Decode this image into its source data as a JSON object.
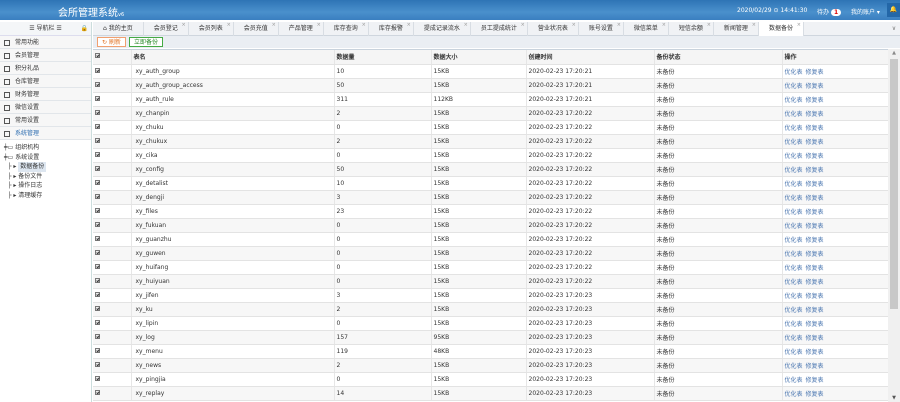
{
  "header": {
    "title": "会所管理系统",
    "version": "v6",
    "datetime": "2020/02/29 ⊙ 14:41:30",
    "todo_label": "待办",
    "todo_count": "1",
    "account": "我的账户 ▾"
  },
  "sidebar": {
    "title": "☰ 导航栏 ☰",
    "menus": [
      "常用功能",
      "会员管理",
      "积分礼品",
      "仓库管理",
      "财务管理",
      "微信设置",
      "常用设置",
      "系统管理"
    ],
    "tree": {
      "org": "组织机构",
      "sys": "系统设置",
      "children": [
        "数据备份",
        "备份文件",
        "操作日志",
        "清理缓存"
      ]
    }
  },
  "tabs": [
    "我的主页",
    "会员登记",
    "会员列表",
    "会员充值",
    "产品管理",
    "库存查询",
    "库存报警",
    "提成记录流水",
    "员工提成统计",
    "营业状况表",
    "账号设置",
    "微信菜单",
    "短信余额",
    "新闻管理",
    "数据备份"
  ],
  "toolbar": {
    "refresh": "↻ 刷新",
    "backup": "立即备份"
  },
  "table": {
    "columns": [
      "表名",
      "数据量",
      "数据大小",
      "创建时间",
      "备份状态",
      "操作"
    ],
    "actions": [
      "优化表",
      "修复表"
    ],
    "rows": [
      [
        "xy_auth_group",
        "10",
        "15KB",
        "2020-02-23 17:20:21",
        "未备份"
      ],
      [
        "xy_auth_group_access",
        "50",
        "15KB",
        "2020-02-23 17:20:21",
        "未备份"
      ],
      [
        "xy_auth_rule",
        "311",
        "112KB",
        "2020-02-23 17:20:21",
        "未备份"
      ],
      [
        "xy_chanpin",
        "2",
        "15KB",
        "2020-02-23 17:20:22",
        "未备份"
      ],
      [
        "xy_chuku",
        "0",
        "15KB",
        "2020-02-23 17:20:22",
        "未备份"
      ],
      [
        "xy_chukux",
        "2",
        "15KB",
        "2020-02-23 17:20:22",
        "未备份"
      ],
      [
        "xy_cika",
        "0",
        "15KB",
        "2020-02-23 17:20:22",
        "未备份"
      ],
      [
        "xy_config",
        "50",
        "15KB",
        "2020-02-23 17:20:22",
        "未备份"
      ],
      [
        "xy_detalist",
        "10",
        "15KB",
        "2020-02-23 17:20:22",
        "未备份"
      ],
      [
        "xy_dengji",
        "3",
        "15KB",
        "2020-02-23 17:20:22",
        "未备份"
      ],
      [
        "xy_files",
        "23",
        "15KB",
        "2020-02-23 17:20:22",
        "未备份"
      ],
      [
        "xy_fukuan",
        "0",
        "15KB",
        "2020-02-23 17:20:22",
        "未备份"
      ],
      [
        "xy_guanzhu",
        "0",
        "15KB",
        "2020-02-23 17:20:22",
        "未备份"
      ],
      [
        "xy_guwen",
        "0",
        "15KB",
        "2020-02-23 17:20:22",
        "未备份"
      ],
      [
        "xy_huifang",
        "0",
        "15KB",
        "2020-02-23 17:20:22",
        "未备份"
      ],
      [
        "xy_huiyuan",
        "0",
        "15KB",
        "2020-02-23 17:20:22",
        "未备份"
      ],
      [
        "xy_jifen",
        "3",
        "15KB",
        "2020-02-23 17:20:23",
        "未备份"
      ],
      [
        "xy_ku",
        "2",
        "15KB",
        "2020-02-23 17:20:23",
        "未备份"
      ],
      [
        "xy_lipin",
        "0",
        "15KB",
        "2020-02-23 17:20:23",
        "未备份"
      ],
      [
        "xy_log",
        "157",
        "95KB",
        "2020-02-23 17:20:23",
        "未备份"
      ],
      [
        "xy_menu",
        "119",
        "48KB",
        "2020-02-23 17:20:23",
        "未备份"
      ],
      [
        "xy_news",
        "2",
        "15KB",
        "2020-02-23 17:20:23",
        "未备份"
      ],
      [
        "xy_pingjia",
        "0",
        "15KB",
        "2020-02-23 17:20:23",
        "未备份"
      ],
      [
        "xy_replay",
        "14",
        "15KB",
        "2020-02-23 17:20:23",
        "未备份"
      ]
    ]
  }
}
